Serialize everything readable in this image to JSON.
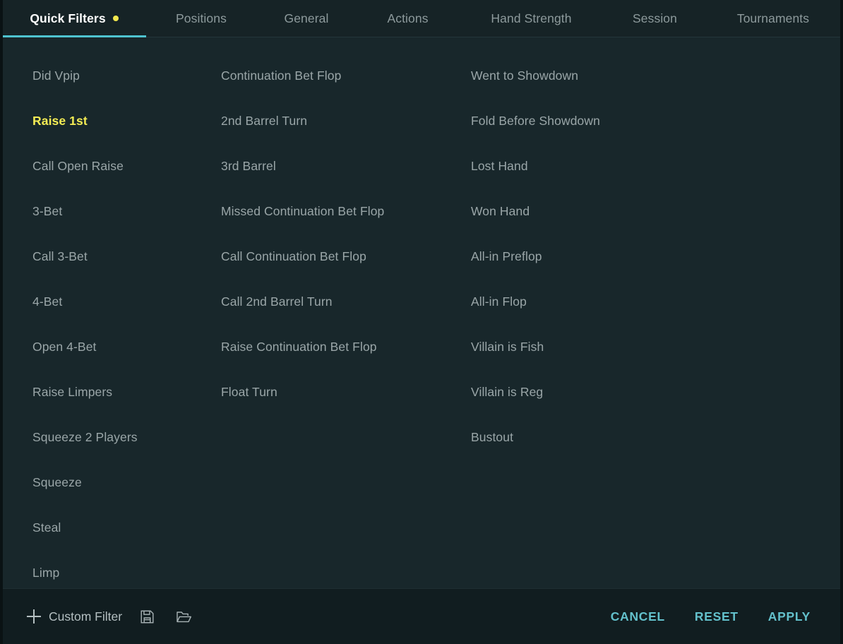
{
  "window": {
    "title": "Quick Filters"
  },
  "tabs": [
    {
      "label": "Quick Filters",
      "active": true,
      "dot": true,
      "dot_color": "#f2e84e"
    },
    {
      "label": "Positions",
      "active": false,
      "dot": false
    },
    {
      "label": "General",
      "active": false,
      "dot": false
    },
    {
      "label": "Actions",
      "active": false,
      "dot": false
    },
    {
      "label": "Hand Strength",
      "active": false,
      "dot": false
    },
    {
      "label": "Session",
      "active": false,
      "dot": false
    },
    {
      "label": "Tournaments",
      "active": false,
      "dot": false
    }
  ],
  "filters": {
    "column_1": [
      {
        "label": "Did Vpip",
        "selected": false
      },
      {
        "label": "Raise 1st",
        "selected": true
      },
      {
        "label": "Call Open Raise",
        "selected": false
      },
      {
        "label": "3-Bet",
        "selected": false
      },
      {
        "label": "Call 3-Bet",
        "selected": false
      },
      {
        "label": "4-Bet",
        "selected": false
      },
      {
        "label": "Open 4-Bet",
        "selected": false
      },
      {
        "label": "Raise Limpers",
        "selected": false
      },
      {
        "label": "Squeeze 2 Players",
        "selected": false
      },
      {
        "label": "Squeeze",
        "selected": false
      },
      {
        "label": "Steal",
        "selected": false
      },
      {
        "label": "Limp",
        "selected": false
      }
    ],
    "column_2": [
      {
        "label": "Continuation Bet Flop",
        "selected": false
      },
      {
        "label": "2nd Barrel Turn",
        "selected": false
      },
      {
        "label": "3rd Barrel",
        "selected": false
      },
      {
        "label": "Missed Continuation Bet Flop",
        "selected": false
      },
      {
        "label": "Call Continuation Bet Flop",
        "selected": false
      },
      {
        "label": "Call 2nd Barrel Turn",
        "selected": false
      },
      {
        "label": "Raise Continuation Bet Flop",
        "selected": false
      },
      {
        "label": "Float Turn",
        "selected": false
      }
    ],
    "column_3": [
      {
        "label": "Went to Showdown",
        "selected": false
      },
      {
        "label": "Fold Before Showdown",
        "selected": false
      },
      {
        "label": "Lost Hand",
        "selected": false
      },
      {
        "label": "Won Hand",
        "selected": false
      },
      {
        "label": "All-in Preflop",
        "selected": false
      },
      {
        "label": "All-in Flop",
        "selected": false
      },
      {
        "label": "Villain is Fish",
        "selected": false
      },
      {
        "label": "Villain is Reg",
        "selected": false
      },
      {
        "label": "Bustout",
        "selected": false
      }
    ]
  },
  "footer": {
    "custom_filter_label": "Custom Filter",
    "plus_icon": "plus-icon",
    "save_icon": "save-floppy-icon",
    "open_icon": "open-folder-icon",
    "cancel_label": "CANCEL",
    "reset_label": "RESET",
    "apply_label": "APPLY"
  },
  "colors": {
    "accent_teal": "#4ec3cf",
    "action_teal": "#63c0cb",
    "selected_yellow": "#f4ec54",
    "tab_dot_yellow": "#f2e84e",
    "text_muted": "#9aa6a8",
    "bg_content": "#18272b",
    "bg_tabbar": "#162326",
    "bg_footer": "#111d20"
  }
}
